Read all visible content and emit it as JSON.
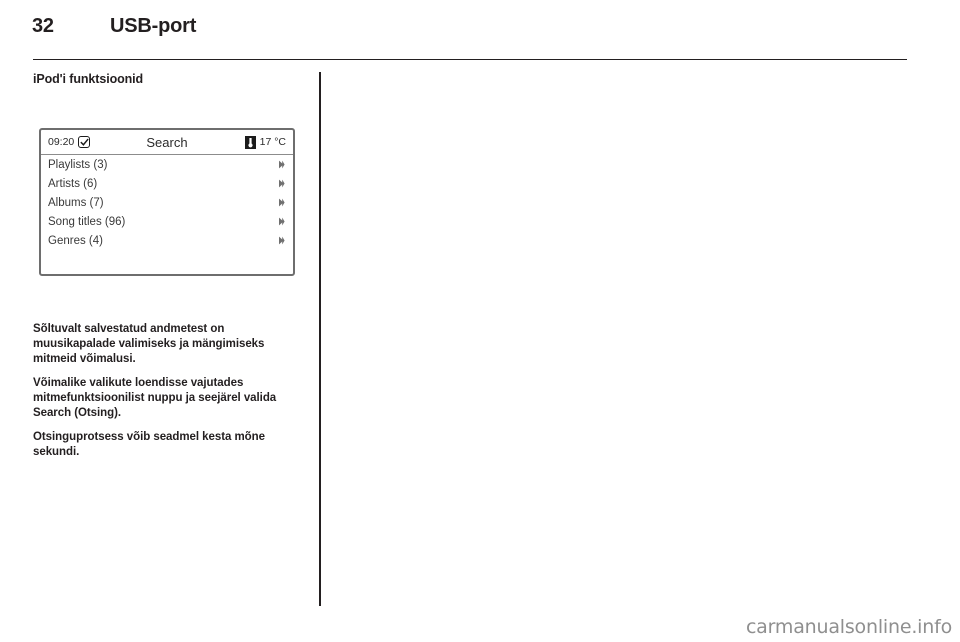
{
  "header": {
    "page_number": "32",
    "chapter_title": "USB-port"
  },
  "section": {
    "heading": "iPod'i funktsioonid"
  },
  "device_screen": {
    "status_bar": {
      "time": "09:20",
      "clock_icon": "clock-check-icon",
      "title": "Search",
      "thermometer_icon": "thermometer-icon",
      "temperature": "17 °C"
    },
    "menu_items": [
      {
        "label": "Playlists (3)",
        "chevron": "chevron-right-icon"
      },
      {
        "label": "Artists (6)",
        "chevron": "chevron-right-icon"
      },
      {
        "label": "Albums (7)",
        "chevron": "chevron-right-icon"
      },
      {
        "label": "Song titles (96)",
        "chevron": "chevron-right-icon"
      },
      {
        "label": "Genres (4)",
        "chevron": "chevron-right-icon"
      }
    ]
  },
  "body": {
    "paragraph_1": "Sõltuvalt salvestatud andmetest on muusikapalade valimiseks ja mängimiseks mitmeid võimalusi.",
    "paragraph_2": "Võimalike valikute loendisse vajutades mitmefunktsioonilist nuppu ja seejärel valida Search (Otsing).",
    "paragraph_3": "Otsinguprotsess võib seadmel kesta mõne sekundi."
  },
  "watermark": {
    "text": "carmanualsonline.info"
  },
  "colors": {
    "ink": "#231f20",
    "screen_border": "#6e6e6e",
    "menu_text": "#3a3a3a",
    "watermark": "#8f8f8f"
  }
}
